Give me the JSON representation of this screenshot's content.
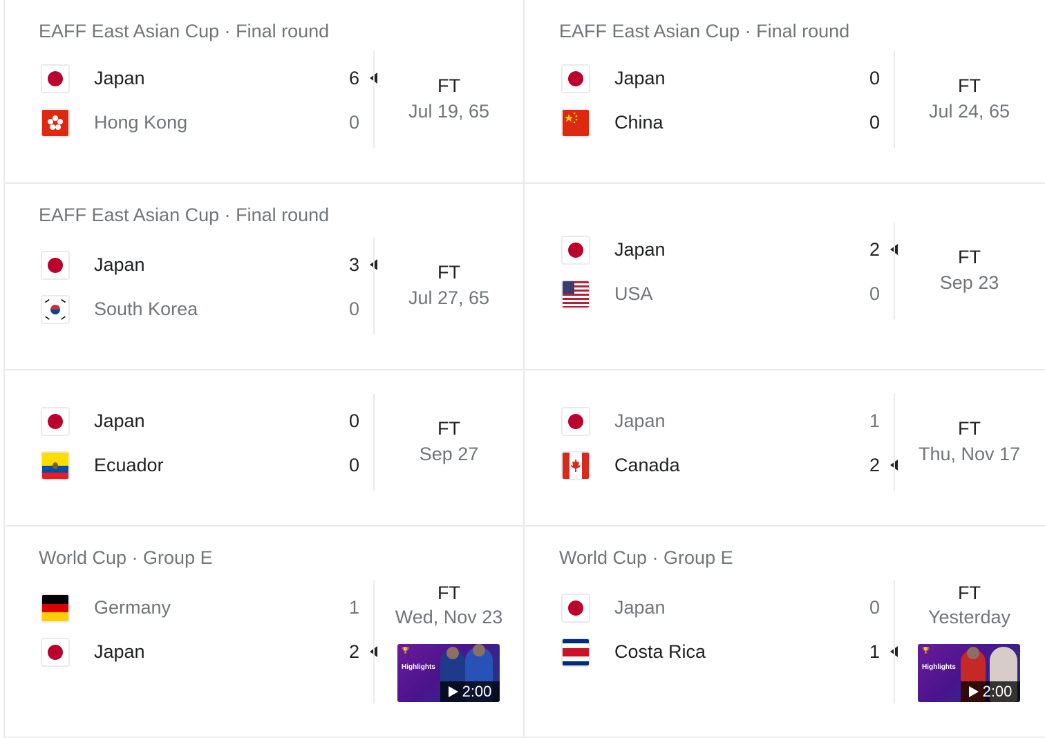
{
  "matches": [
    {
      "league": "EAFF East Asian Cup · Final round",
      "status": "FT",
      "date": "Jul 19, 65",
      "teams": [
        {
          "name": "Japan",
          "score": "6",
          "winner": true,
          "flag": "japan-flag-icon"
        },
        {
          "name": "Hong Kong",
          "score": "0",
          "winner": false,
          "flag": "hong-kong-flag-icon"
        }
      ]
    },
    {
      "league": "EAFF East Asian Cup · Final round",
      "status": "FT",
      "date": "Jul 24, 65",
      "teams": [
        {
          "name": "Japan",
          "score": "0",
          "winner": false,
          "flag": "japan-flag-icon"
        },
        {
          "name": "China",
          "score": "0",
          "winner": false,
          "flag": "china-flag-icon"
        }
      ]
    },
    {
      "league": "EAFF East Asian Cup · Final round",
      "status": "FT",
      "date": "Jul 27, 65",
      "teams": [
        {
          "name": "Japan",
          "score": "3",
          "winner": true,
          "flag": "japan-flag-icon"
        },
        {
          "name": "South Korea",
          "score": "0",
          "winner": false,
          "flag": "south-korea-flag-icon"
        }
      ]
    },
    {
      "league": "",
      "status": "FT",
      "date": "Sep 23",
      "teams": [
        {
          "name": "Japan",
          "score": "2",
          "winner": true,
          "flag": "japan-flag-icon"
        },
        {
          "name": "USA",
          "score": "0",
          "winner": false,
          "flag": "usa-flag-icon"
        }
      ]
    },
    {
      "league": "",
      "status": "FT",
      "date": "Sep 27",
      "teams": [
        {
          "name": "Japan",
          "score": "0",
          "winner": false,
          "flag": "japan-flag-icon"
        },
        {
          "name": "Ecuador",
          "score": "0",
          "winner": false,
          "flag": "ecuador-flag-icon"
        }
      ]
    },
    {
      "league": "",
      "status": "FT",
      "date": "Thu, Nov 17",
      "teams": [
        {
          "name": "Japan",
          "score": "1",
          "winner": false,
          "flag": "japan-flag-icon"
        },
        {
          "name": "Canada",
          "score": "2",
          "winner": true,
          "flag": "canada-flag-icon"
        }
      ]
    },
    {
      "league": "World Cup · Group E",
      "status": "FT",
      "date": "Wed, Nov 23",
      "highlights": {
        "label": "Highlights",
        "duration": "2:00"
      },
      "teams": [
        {
          "name": "Germany",
          "score": "1",
          "winner": false,
          "flag": "germany-flag-icon"
        },
        {
          "name": "Japan",
          "score": "2",
          "winner": true,
          "flag": "japan-flag-icon"
        }
      ]
    },
    {
      "league": "World Cup · Group E",
      "status": "FT",
      "date": "Yesterday",
      "highlights": {
        "label": "Highlights",
        "duration": "2:00"
      },
      "teams": [
        {
          "name": "Japan",
          "score": "0",
          "winner": false,
          "flag": "japan-flag-icon"
        },
        {
          "name": "Costa Rica",
          "score": "1",
          "winner": true,
          "flag": "costa-rica-flag-icon"
        }
      ]
    }
  ]
}
